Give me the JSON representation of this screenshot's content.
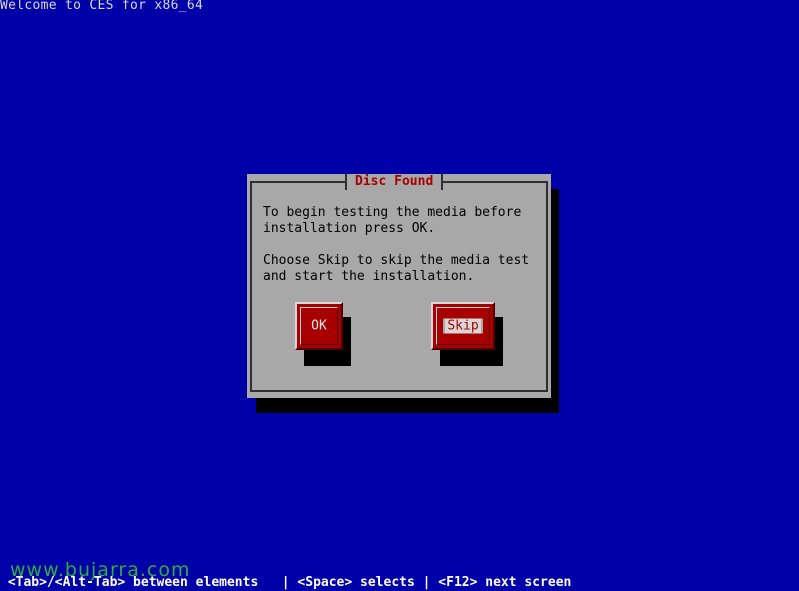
{
  "screen": {
    "title": "Welcome to CES for x86_64"
  },
  "dialog": {
    "title": "Disc Found",
    "message_line1": "To begin testing the media before",
    "message_line2": "installation press OK.",
    "message_line3": "Choose Skip to skip the media test",
    "message_line4": "and start the installation.",
    "ok_label": "OK",
    "skip_label": "Skip",
    "focused_button": "Skip"
  },
  "watermark": {
    "text": "www.bujarra.com"
  },
  "status_bar": {
    "text": " <Tab>/<Alt-Tab> between elements   | <Space> selects | <F12> next screen"
  },
  "colors": {
    "background": "#0000a8",
    "dialog": "#a8a8a8",
    "button": "#a80000",
    "title_text": "#a80000",
    "watermark": "#33cc33"
  }
}
